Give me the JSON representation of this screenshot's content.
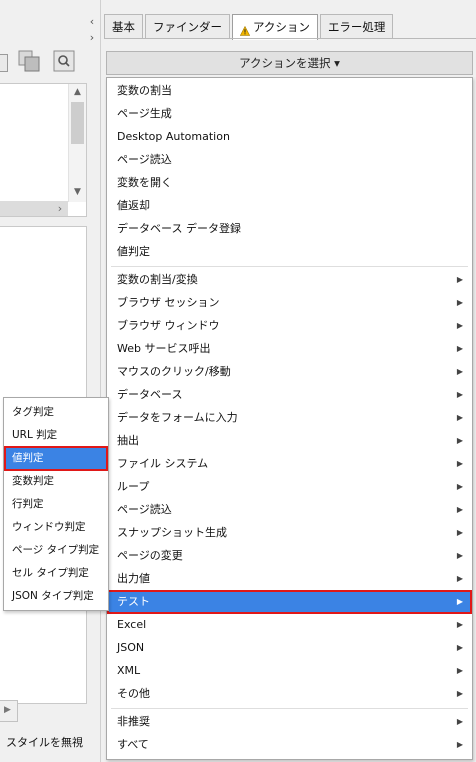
{
  "tabs": [
    {
      "label": "基本",
      "active": false
    },
    {
      "label": "ファインダー",
      "active": false
    },
    {
      "label": "アクション",
      "active": true,
      "warning": true
    },
    {
      "label": "エラー処理",
      "active": false
    }
  ],
  "select_action_label": "アクションを選択 ▾",
  "left_panel": {
    "ignore_style_label": "スタイルを無視"
  },
  "main_menu": {
    "group1": [
      {
        "label": "変数の割当"
      },
      {
        "label": "ページ生成"
      },
      {
        "label": "Desktop Automation"
      },
      {
        "label": "ページ読込"
      },
      {
        "label": "変数を開く"
      },
      {
        "label": "値返却"
      },
      {
        "label": "データベース データ登録"
      },
      {
        "label": "値判定"
      }
    ],
    "group2": [
      {
        "label": "変数の割当/変換",
        "submenu": true
      },
      {
        "label": "ブラウザ セッション",
        "submenu": true
      },
      {
        "label": "ブラウザ ウィンドウ",
        "submenu": true
      },
      {
        "label": "Web サービス呼出",
        "submenu": true
      },
      {
        "label": "マウスのクリック/移動",
        "submenu": true
      },
      {
        "label": "データベース",
        "submenu": true
      },
      {
        "label": "データをフォームに入力",
        "submenu": true
      },
      {
        "label": "抽出",
        "submenu": true
      },
      {
        "label": "ファイル システム",
        "submenu": true
      },
      {
        "label": "ループ",
        "submenu": true
      },
      {
        "label": "ページ読込",
        "submenu": true
      },
      {
        "label": "スナップショット生成",
        "submenu": true
      },
      {
        "label": "ページの変更",
        "submenu": true
      },
      {
        "label": "出力値",
        "submenu": true
      },
      {
        "label": "テスト",
        "submenu": true,
        "highlighted": true
      },
      {
        "label": "Excel",
        "submenu": true
      },
      {
        "label": "JSON",
        "submenu": true
      },
      {
        "label": "XML",
        "submenu": true
      },
      {
        "label": "その他",
        "submenu": true
      }
    ],
    "group3": [
      {
        "label": "非推奨",
        "submenu": true
      },
      {
        "label": "すべて",
        "submenu": true
      }
    ]
  },
  "sub_menu": [
    {
      "label": "タグ判定"
    },
    {
      "label": "URL 判定"
    },
    {
      "label": "値判定",
      "highlighted": true
    },
    {
      "label": "変数判定"
    },
    {
      "label": "行判定"
    },
    {
      "label": "ウィンドウ判定"
    },
    {
      "label": "ページ タイプ判定"
    },
    {
      "label": "セル タイプ判定"
    },
    {
      "label": "JSON タイプ判定"
    }
  ],
  "icons": {
    "submenu_arrow": "chevron-right-icon",
    "warning": "warning-icon",
    "tab_scroll": "chevron-left-right-icon"
  },
  "colors": {
    "highlight": "#3b83e4",
    "highlight_border": "#e01818",
    "warning": "#f2b600"
  }
}
